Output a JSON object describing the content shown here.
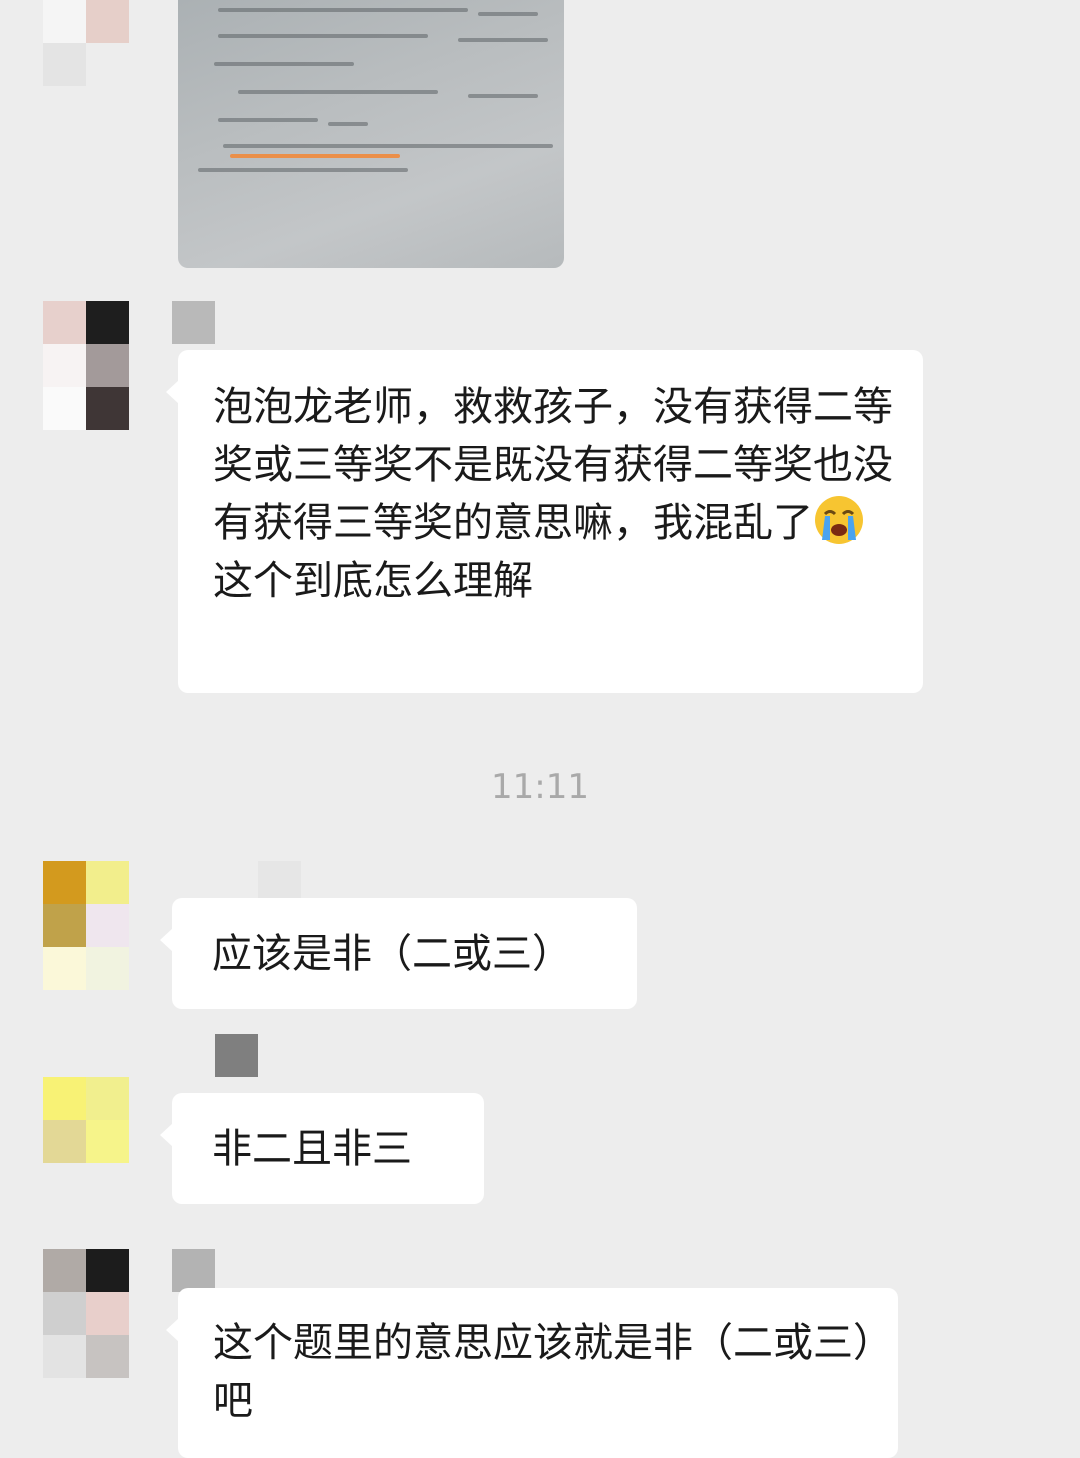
{
  "messages": {
    "m1": {
      "text_before": "泡泡龙老师，救救孩子，没有获得二等奖或三等奖不是既没有获得二等奖也没有获得三等奖的意思嘛，我混乱了",
      "emoji": "loudly-crying-face-icon",
      "text_after": "这个到底怎么理解"
    },
    "timestamp": "11:11",
    "m2": {
      "text": "应该是非（二或三）"
    },
    "m3": {
      "text": "非二且非三"
    },
    "m4": {
      "text": "这个题里的意思应该就是非（二或三）吧"
    }
  },
  "colors": {
    "background": "#ededed",
    "bubble": "#ffffff",
    "text": "#1a1a1a",
    "timestamp": "#a9a9a9",
    "photo_highlight": "#f08a3c"
  }
}
